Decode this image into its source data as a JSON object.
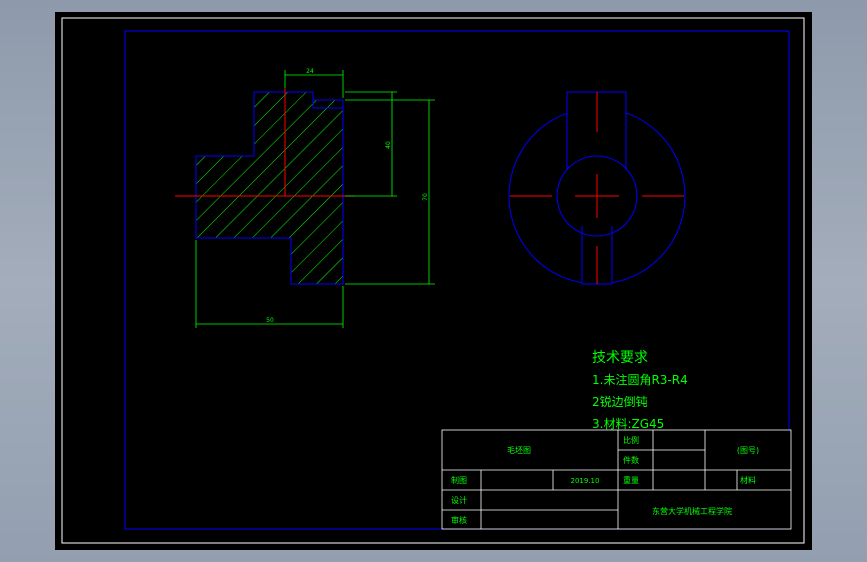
{
  "drawing": {
    "dimensions": {
      "top_width": "24",
      "inner_height": "40",
      "outer_height": "70",
      "bottom_length": "50"
    },
    "tech_requirements": {
      "heading": "技术要求",
      "line1": "1.未注圆角R3-R4",
      "line2": "2锐边倒钝",
      "line3": "3.材料:ZG45"
    },
    "title_block": {
      "part_name": "毛坯图",
      "scale_label": "比例",
      "count_label": "件数",
      "drawing_no": "(图号)",
      "weight_label": "重量",
      "material_label": "材料",
      "drawn_label": "制图",
      "date": "2019.10",
      "designed_label": "设计",
      "reviewed_label": "审核",
      "school": "东营大学机械工程学院"
    },
    "colors": {
      "outline": "#0000ff",
      "hatch": "#00ff00",
      "centerline": "#ff0000",
      "text": "#00ff00",
      "border": "#ffffff"
    }
  }
}
